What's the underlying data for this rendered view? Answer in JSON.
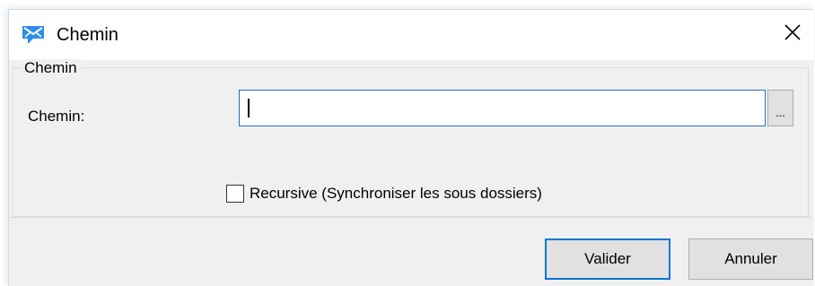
{
  "window": {
    "title": "Chemin",
    "icon": "sync-mail-icon",
    "close_glyph": "✕"
  },
  "group": {
    "legend": "Chemin",
    "path_label": "Chemin:",
    "path_value": "",
    "browse_label": "..."
  },
  "options": {
    "recursive_label": "Recursive (Synchroniser les sous dossiers)",
    "recursive_checked": false
  },
  "buttons": {
    "ok_label": "Valider",
    "cancel_label": "Annuler"
  },
  "colors": {
    "accent": "#0078d7",
    "icon_blue": "#2c8ee8",
    "background": "#f0f0f0"
  }
}
